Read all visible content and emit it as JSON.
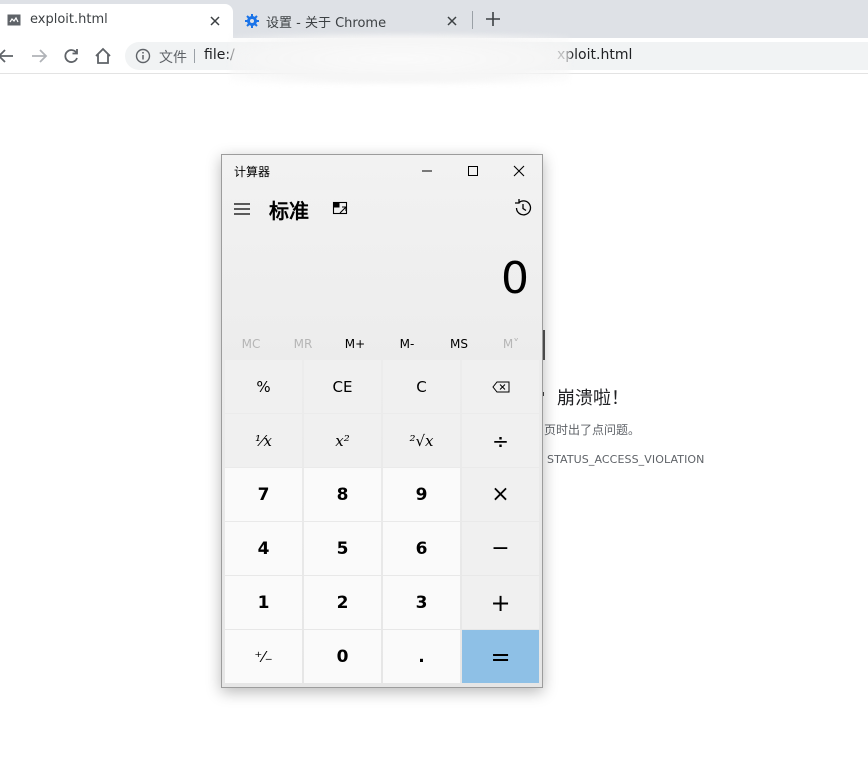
{
  "browser": {
    "tabs": [
      {
        "title": "exploit.html",
        "active": true,
        "icon": "broken-page-icon"
      },
      {
        "title": "设置 - 关于 Chrome",
        "active": false,
        "icon": "gear-icon"
      }
    ],
    "omnibox": {
      "scheme_label": "文件",
      "url_prefix": "file:/",
      "url_suffix": "xploit.html"
    }
  },
  "crash_page": {
    "title": "崩溃啦！",
    "description": "页时出了点问题。",
    "error_code": "STATUS_ACCESS_VIOLATION"
  },
  "calculator": {
    "window_title": "计算器",
    "mode": "标准",
    "display_value": "0",
    "memory_buttons": [
      {
        "label": "MC",
        "enabled": false
      },
      {
        "label": "MR",
        "enabled": false
      },
      {
        "label": "M+",
        "enabled": true
      },
      {
        "label": "M-",
        "enabled": true
      },
      {
        "label": "MS",
        "enabled": true
      },
      {
        "label": "M˅",
        "enabled": false
      }
    ],
    "keys": {
      "percent": "%",
      "clear_entry": "CE",
      "clear": "C",
      "reciprocal": "¹⁄x",
      "square": "x²",
      "sqrt": "²√x",
      "divide": "÷",
      "seven": "7",
      "eight": "8",
      "nine": "9",
      "multiply": "×",
      "four": "4",
      "five": "5",
      "six": "6",
      "minus": "−",
      "one": "1",
      "two": "2",
      "three": "3",
      "plus": "+",
      "negate": "⁺⁄₋",
      "zero": "0",
      "decimal": ".",
      "equals": "="
    },
    "colors": {
      "equals_key": "#8ec0e6",
      "number_key": "#fafafa",
      "operator_key": "#f0f0f0"
    }
  }
}
